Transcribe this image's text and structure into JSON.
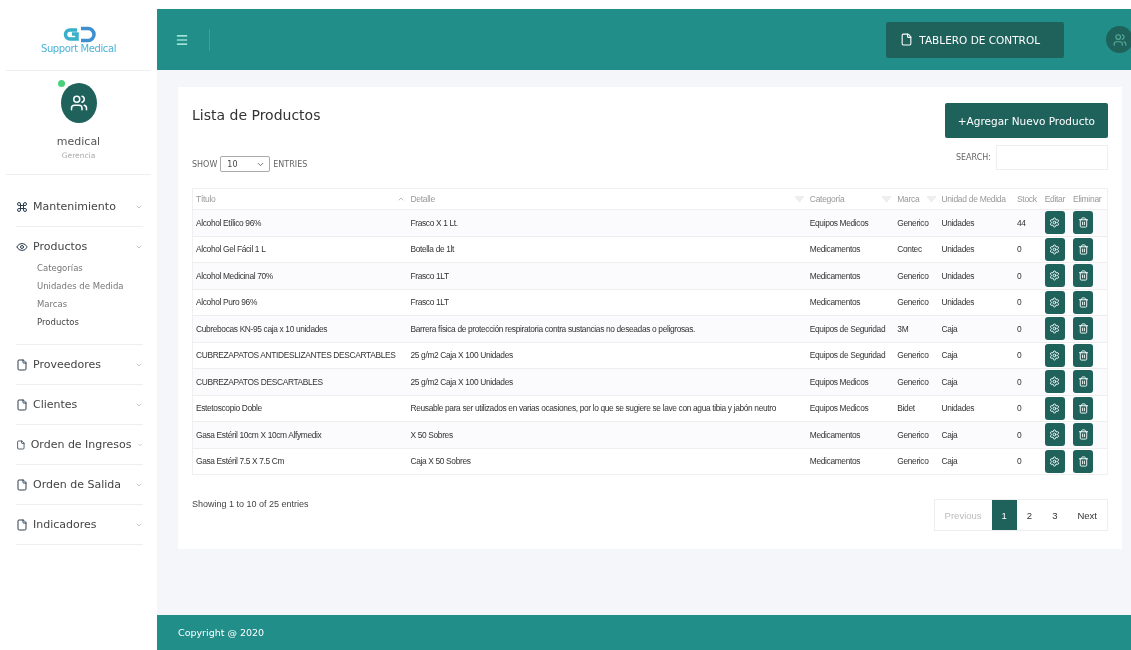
{
  "brand": {
    "name": "Support Medical"
  },
  "user": {
    "name": "medical",
    "role": "Gerencia",
    "online": true
  },
  "menu": [
    {
      "label": "Mantenimiento"
    },
    {
      "label": "Productos",
      "children": [
        {
          "label": "Categorías",
          "selected": false
        },
        {
          "label": "Unidades de Medida",
          "selected": false
        },
        {
          "label": "Marcas",
          "selected": false
        },
        {
          "label": "Productos",
          "selected": true
        }
      ]
    },
    {
      "label": "Proveedores"
    },
    {
      "label": "Clientes"
    },
    {
      "label": "Orden de Ingresos"
    },
    {
      "label": "Orden de Salida"
    },
    {
      "label": "Indicadores"
    }
  ],
  "topbar": {
    "dashboard_button": "TABLERO DE CONTROL"
  },
  "card": {
    "title": "Lista de Productos",
    "add_button": "+Agregar Nuevo Producto",
    "show_label": "SHOW",
    "entries_value": "10",
    "entries_label": "ENTRIES",
    "search_label": "SEARCH:"
  },
  "table": {
    "columns": [
      {
        "label": "Título",
        "sorted": true
      },
      {
        "label": "Detalle",
        "sorted": false
      },
      {
        "label": "Categoría",
        "sorted": false
      },
      {
        "label": "Marca",
        "sorted": false
      },
      {
        "label": "Unidad de Medida"
      },
      {
        "label": "Stock"
      },
      {
        "label": "Editar"
      },
      {
        "label": "Eliminar"
      }
    ],
    "rows": [
      [
        "Alcohol Etílico 96%",
        "Frasco X 1 Lt.",
        "Equipos Medicos",
        "Generico",
        "Unidades",
        "44"
      ],
      [
        "Alcohol Gel Fácil 1 L",
        "Botella de 1lt",
        "Medicamentos",
        "Contec",
        "Unidades",
        "0"
      ],
      [
        "Alcohol Medicinal 70%",
        "Frasco 1LT",
        "Medicamentos",
        "Generico",
        "Unidades",
        "0"
      ],
      [
        "Alcohol Puro 96%",
        "Frasco 1LT",
        "Medicamentos",
        "Generico",
        "Unidades",
        "0"
      ],
      [
        "Cubrebocas KN-95 caja x 10 unidades",
        "Barrera física de protección respiratoria contra sustancias no deseadas o peligrosas.",
        "Equipos de Seguridad",
        "3M",
        "Caja",
        "0"
      ],
      [
        "CUBREZAPATOS ANTIDESLIZANTES DESCARTABLES",
        "25 g/m2 Caja X 100 Unidades",
        "Equipos de Seguridad",
        "Generico",
        "Caja",
        "0"
      ],
      [
        "CUBREZAPATOS DESCARTABLES",
        "25 g/m2 Caja X 100 Unidades",
        "Equipos Medicos",
        "Generico",
        "Caja",
        "0"
      ],
      [
        "Estetoscopio Doble",
        "Reusable para ser utilizados en varias ocasiones, por lo que se sugiere se lave con agua tibia y jabón neutro",
        "Equipos Medicos",
        "Bidet",
        "Unidades",
        "0"
      ],
      [
        "Gasa Estéril 10cm X 10cm Alfymedix",
        "X 50 Sobres",
        "Medicamentos",
        "Generico",
        "Caja",
        "0"
      ],
      [
        "Gasa Estéril 7.5 X 7.5 Cm",
        "Caja X 50 Sobres",
        "Medicamentos",
        "Generico",
        "Caja",
        "0"
      ]
    ]
  },
  "info": "Showing 1 to 10 of 25 entries",
  "pagination": [
    {
      "label": "Previous",
      "disabled": true,
      "selected": false
    },
    {
      "label": "1",
      "disabled": false,
      "selected": true
    },
    {
      "label": "2",
      "disabled": false,
      "selected": false
    },
    {
      "label": "3",
      "disabled": false,
      "selected": false
    },
    {
      "label": "Next",
      "disabled": false,
      "selected": false
    }
  ],
  "footer": "Copyright @ 2020"
}
